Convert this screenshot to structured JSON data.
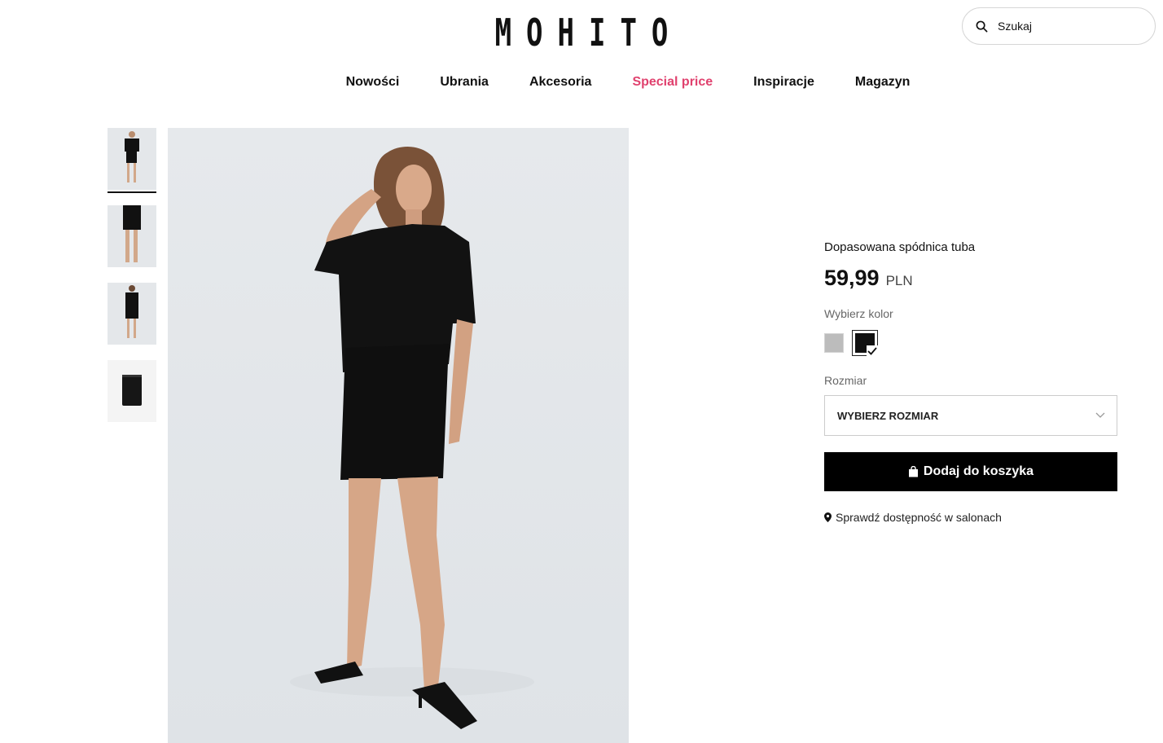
{
  "header": {
    "logo": "MOHITO",
    "search_placeholder": "Szukaj"
  },
  "nav": {
    "items": [
      {
        "label": "Nowości"
      },
      {
        "label": "Ubrania"
      },
      {
        "label": "Akcesoria"
      },
      {
        "label": "Special price",
        "color": "#e0416e"
      },
      {
        "label": "Inspiracje"
      },
      {
        "label": "Magazyn"
      }
    ]
  },
  "gallery": {
    "thumbnail_count": 4,
    "active_thumbnail": 1
  },
  "product": {
    "title": "Dopasowana spódnica tuba",
    "price": "59,99",
    "currency": "PLN",
    "color_label": "Wybierz kolor",
    "colors": [
      {
        "name": "grey",
        "hex": "#bcbcbc",
        "selected": false
      },
      {
        "name": "black",
        "hex": "#111111",
        "selected": true
      }
    ],
    "size_label": "Rozmiar",
    "size_placeholder": "WYBIERZ ROZMIAR",
    "add_to_cart": "Dodaj do koszyka",
    "availability": "Sprawdź dostępność w salonach"
  }
}
